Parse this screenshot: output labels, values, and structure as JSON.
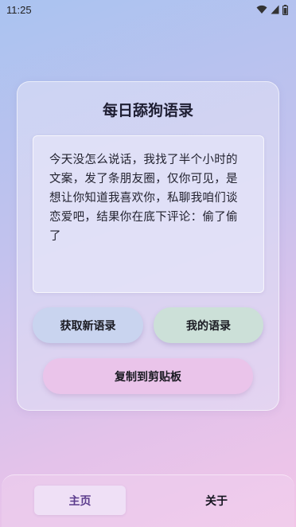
{
  "status_bar": {
    "time": "11:25",
    "icons": [
      "wifi-icon",
      "signal-icon",
      "battery-icon"
    ]
  },
  "card": {
    "title": "每日舔狗语录",
    "quote": "今天没怎么说话，我找了半个小时的文案，发了条朋友圈，仅你可见，是想让你知道我喜欢你，私聊我咱们谈恋爱吧，结果你在底下评论：偷了偷了"
  },
  "buttons": {
    "new_quote": "获取新语录",
    "my_quotes": "我的语录",
    "copy": "复制到剪贴板"
  },
  "nav": {
    "home": "主页",
    "about": "关于"
  },
  "colors": {
    "home_active_text": "#5b3b8c",
    "btn_new_bg": "#c9d4ef",
    "btn_mine_bg": "#cce0d8",
    "btn_copy_bg": "#eac4ea"
  }
}
